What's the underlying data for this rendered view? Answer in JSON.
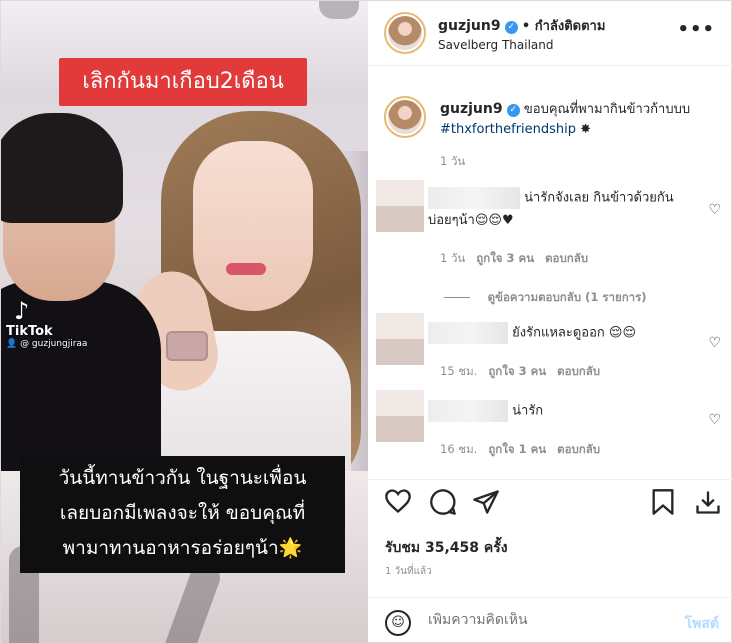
{
  "photo": {
    "caption_top": "เลิกกันมาเกือบ2เดือน",
    "caption_bottom_lines": [
      "วันนี้ทานข้าวกัน ในฐานะเพื่อน",
      "เลยบอกมีเพลงจะให้ ขอบคุณที่",
      "พามาทานอาหารอร่อยๆน้า🌟"
    ],
    "tiktok_logo": "♪",
    "tiktok_label": "TikTok",
    "tiktok_handle": "👤 @ guzjungjiraa"
  },
  "header": {
    "username": "guzjun9",
    "follow_status": "• กำลังติดตาม",
    "location": "Savelberg Thailand",
    "more_icon": "•••"
  },
  "caption": {
    "username": "guzjun9",
    "text": "ขอบคุณที่พามากินข้าวก้าบบบ",
    "hashtag": "#thxforthefriendship",
    "emoji": "✸",
    "time": "1 วัน"
  },
  "comments": [
    {
      "text": "น่ารักจังเลย กินข้าวด้วยกัน",
      "text2": "บ่อยๆน้า😌😌♥",
      "time": "1 วัน",
      "likes": "ถูกใจ 3 คน",
      "reply": "ตอบกลับ",
      "view_replies": "ดูข้อความตอบกลับ (1 รายการ)"
    },
    {
      "text": "ยังรักแหละดูออก 😌😌",
      "time": "15 ชม.",
      "likes": "ถูกใจ 3 คน",
      "reply": "ตอบกลับ"
    },
    {
      "text": "น่ารัก",
      "time": "16 ชม.",
      "likes": "ถูกใจ 1 คน",
      "reply": "ตอบกลับ"
    }
  ],
  "actions": {
    "likes": "รับชม 35,458 ครั้ง",
    "posted": "1 วันที่แล้ว"
  },
  "add_comment": {
    "placeholder": "เพิ่มความคิดเห็น",
    "post_label": "โพสต์"
  }
}
